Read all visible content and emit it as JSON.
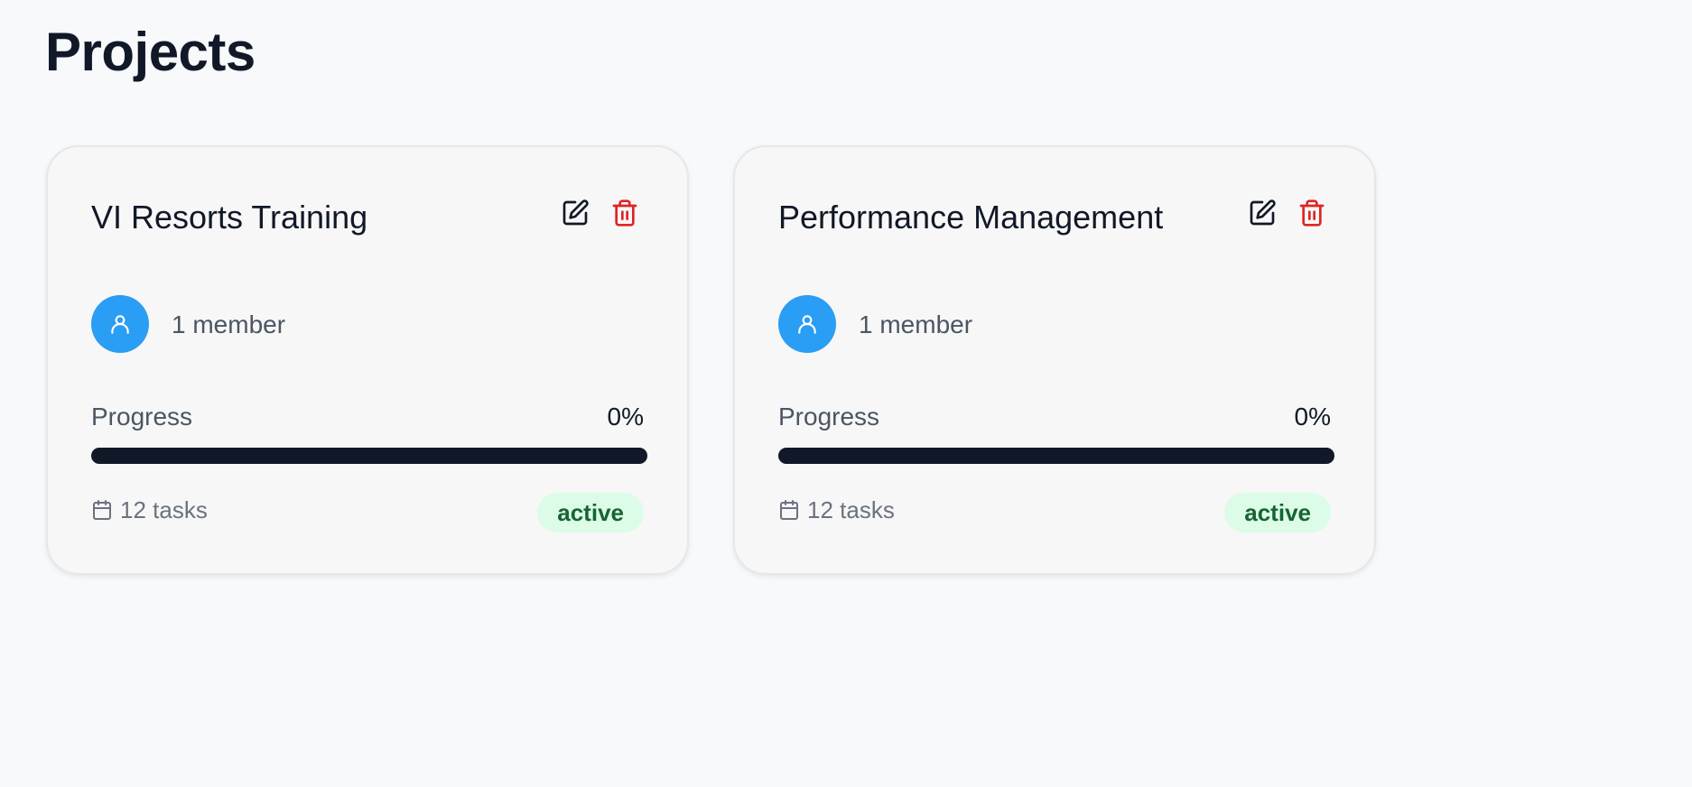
{
  "page": {
    "title": "Projects"
  },
  "projects": [
    {
      "title": "VI Resorts Training",
      "members": "1 member",
      "progress_label": "Progress",
      "progress_value": "0%",
      "progress_fraction": 0,
      "tasks": "12 tasks",
      "status": "active",
      "icons": {
        "edit": "edit-icon",
        "delete": "trash-icon",
        "avatar": "user-icon",
        "tasks": "calendar-icon"
      }
    },
    {
      "title": "Performance Management",
      "members": "1 member",
      "progress_label": "Progress",
      "progress_value": "0%",
      "progress_fraction": 0,
      "tasks": "12 tasks",
      "status": "active",
      "icons": {
        "edit": "edit-icon",
        "delete": "trash-icon",
        "avatar": "user-icon",
        "tasks": "calendar-icon"
      }
    }
  ],
  "colors": {
    "background": "#f8f9fb",
    "card_background": "#f6f7f6",
    "text_primary": "#111827",
    "text_secondary": "#4b5563",
    "avatar": "#2a9df4",
    "delete_icon": "#dc2626",
    "progress_track": "#111827",
    "badge_background": "#dcfce7",
    "badge_text": "#166534"
  }
}
